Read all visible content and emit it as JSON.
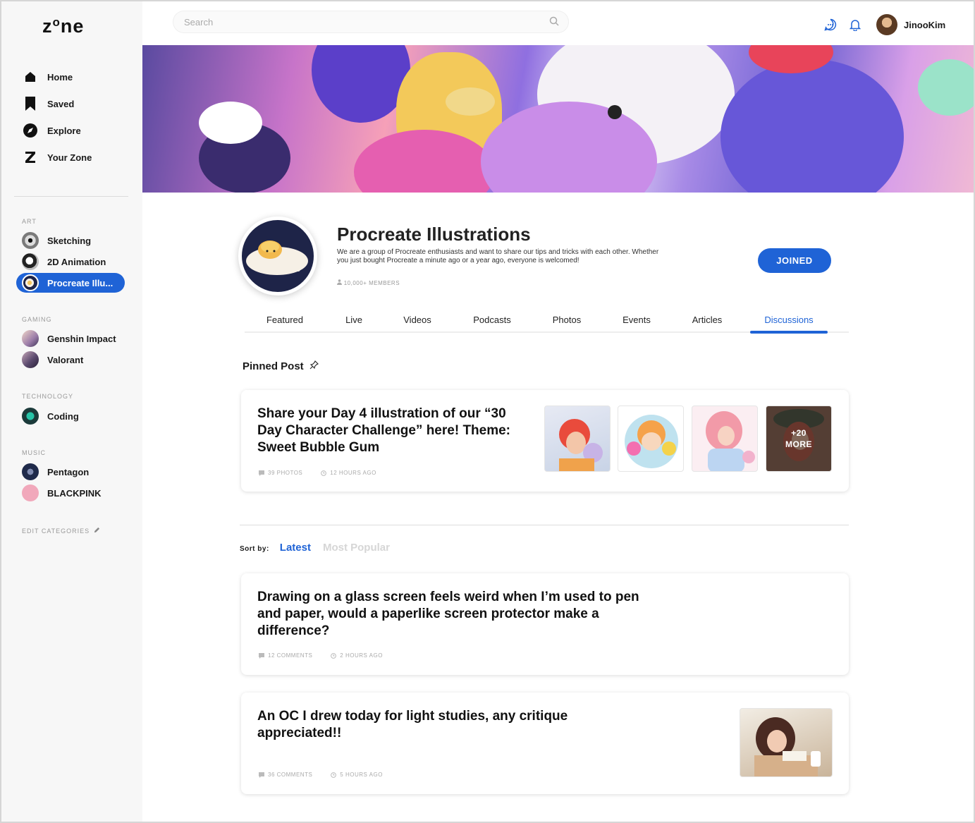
{
  "app": {
    "logo": "zone"
  },
  "nav": {
    "items": [
      {
        "label": "Home",
        "icon": "home-icon"
      },
      {
        "label": "Saved",
        "icon": "bookmark-icon"
      },
      {
        "label": "Explore",
        "icon": "compass-icon"
      },
      {
        "label": "Your Zone",
        "icon": "zone-icon"
      }
    ]
  },
  "categories": [
    {
      "label": "ART",
      "items": [
        {
          "label": "Sketching",
          "color": "#8d8d8d"
        },
        {
          "label": "2D Animation",
          "color": "#444444"
        },
        {
          "label": "Procreate Illu...",
          "color": "#1e2448",
          "active": true
        }
      ]
    },
    {
      "label": "GAMING",
      "items": [
        {
          "label": "Genshin Impact",
          "color": "#c9a6c9"
        },
        {
          "label": "Valorant",
          "color": "#5b4a6e"
        }
      ]
    },
    {
      "label": "TECHNOLOGY",
      "items": [
        {
          "label": "Coding",
          "color": "#1b3a3a"
        }
      ]
    },
    {
      "label": "MUSIC",
      "items": [
        {
          "label": "Pentagon",
          "color": "#1f2a4a"
        },
        {
          "label": "BLACKPINK",
          "color": "#f1a8bb"
        }
      ]
    }
  ],
  "edit_categories": "EDIT CATEGORIES",
  "search": {
    "placeholder": "Search"
  },
  "user": {
    "name": "JinooKim"
  },
  "group": {
    "title": "Procreate Illustrations",
    "description": "We are a group of Procreate enthusiasts and want to share our tips and tricks with each other. Whether you just bought Procreate a minute ago or a year ago, everyone is welcomed!",
    "members": "10,000+ MEMBERS",
    "join_label": "JOINED"
  },
  "tabs": [
    "Featured",
    "Live",
    "Videos",
    "Podcasts",
    "Photos",
    "Events",
    "Articles",
    "Discussions"
  ],
  "active_tab": "Discussions",
  "pinned": {
    "heading": "Pinned Post",
    "title": "Share your Day 4 illustration of our “30 Day Character Challenge” here! Theme: Sweet Bubble Gum",
    "photos": "39 PHOTOS",
    "time": "12 HOURS AGO",
    "more": "+20 MORE"
  },
  "sort": {
    "label": "Sort by:",
    "latest": "Latest",
    "popular": "Most Popular"
  },
  "posts": [
    {
      "title": "Drawing on a glass screen feels weird when I’m used to pen and paper, would a paperlike screen protector make a difference?",
      "comments": "12 COMMENTS",
      "time": "2 HOURS AGO"
    },
    {
      "title": "An OC I drew today for light studies, any critique appreciated!!",
      "comments": "36 COMMENTS",
      "time": "5 HOURS AGO"
    }
  ],
  "colors": {
    "accent": "#1f63d6",
    "sidebar": "#f7f7f7"
  }
}
